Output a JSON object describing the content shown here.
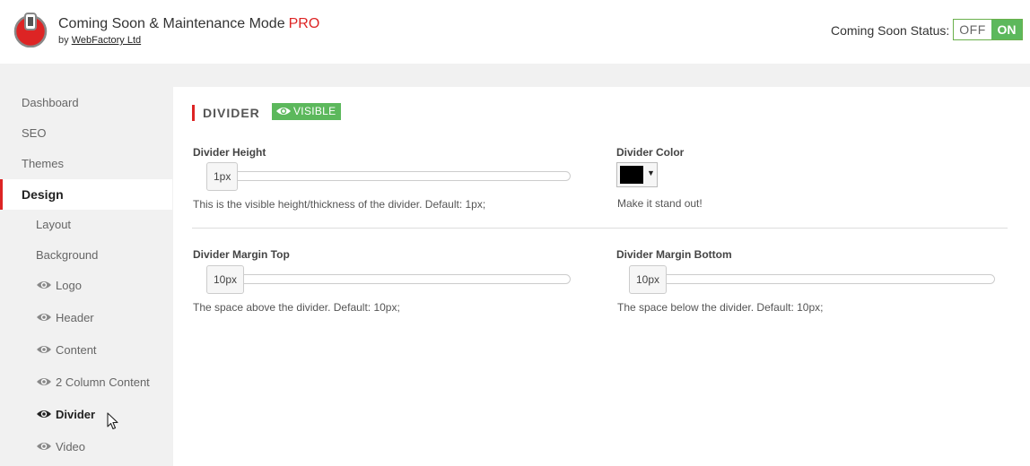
{
  "header": {
    "title": "Coming Soon & Maintenance Mode",
    "title_suffix": "PRO",
    "by_text": "by",
    "author": "WebFactory Ltd",
    "status_label": "Coming Soon Status:",
    "toggle_off": "OFF",
    "toggle_on": "ON"
  },
  "sidebar": {
    "items": [
      {
        "label": "Dashboard"
      },
      {
        "label": "SEO"
      },
      {
        "label": "Themes"
      },
      {
        "label": "Design"
      },
      {
        "label": "Layout"
      },
      {
        "label": "Background"
      },
      {
        "label": "Logo"
      },
      {
        "label": "Header"
      },
      {
        "label": "Content"
      },
      {
        "label": "2 Column Content"
      },
      {
        "label": "Divider"
      },
      {
        "label": "Video"
      }
    ]
  },
  "panel": {
    "section_title": "DIVIDER",
    "badge": "VISIBLE",
    "fields": {
      "height": {
        "label": "Divider Height",
        "value": "1px",
        "help": "This is the visible height/thickness of the divider. Default: 1px;"
      },
      "color": {
        "label": "Divider Color",
        "value": "#000000",
        "help": "Make it stand out!"
      },
      "margin_top": {
        "label": "Divider Margin Top",
        "value": "10px",
        "help": "The space above the divider. Default: 10px;"
      },
      "margin_bottom": {
        "label": "Divider Margin Bottom",
        "value": "10px",
        "help": "The space below the divider. Default: 10px;"
      }
    }
  },
  "colors": {
    "accent_red": "#dd2424",
    "success_green": "#5cb85c"
  }
}
